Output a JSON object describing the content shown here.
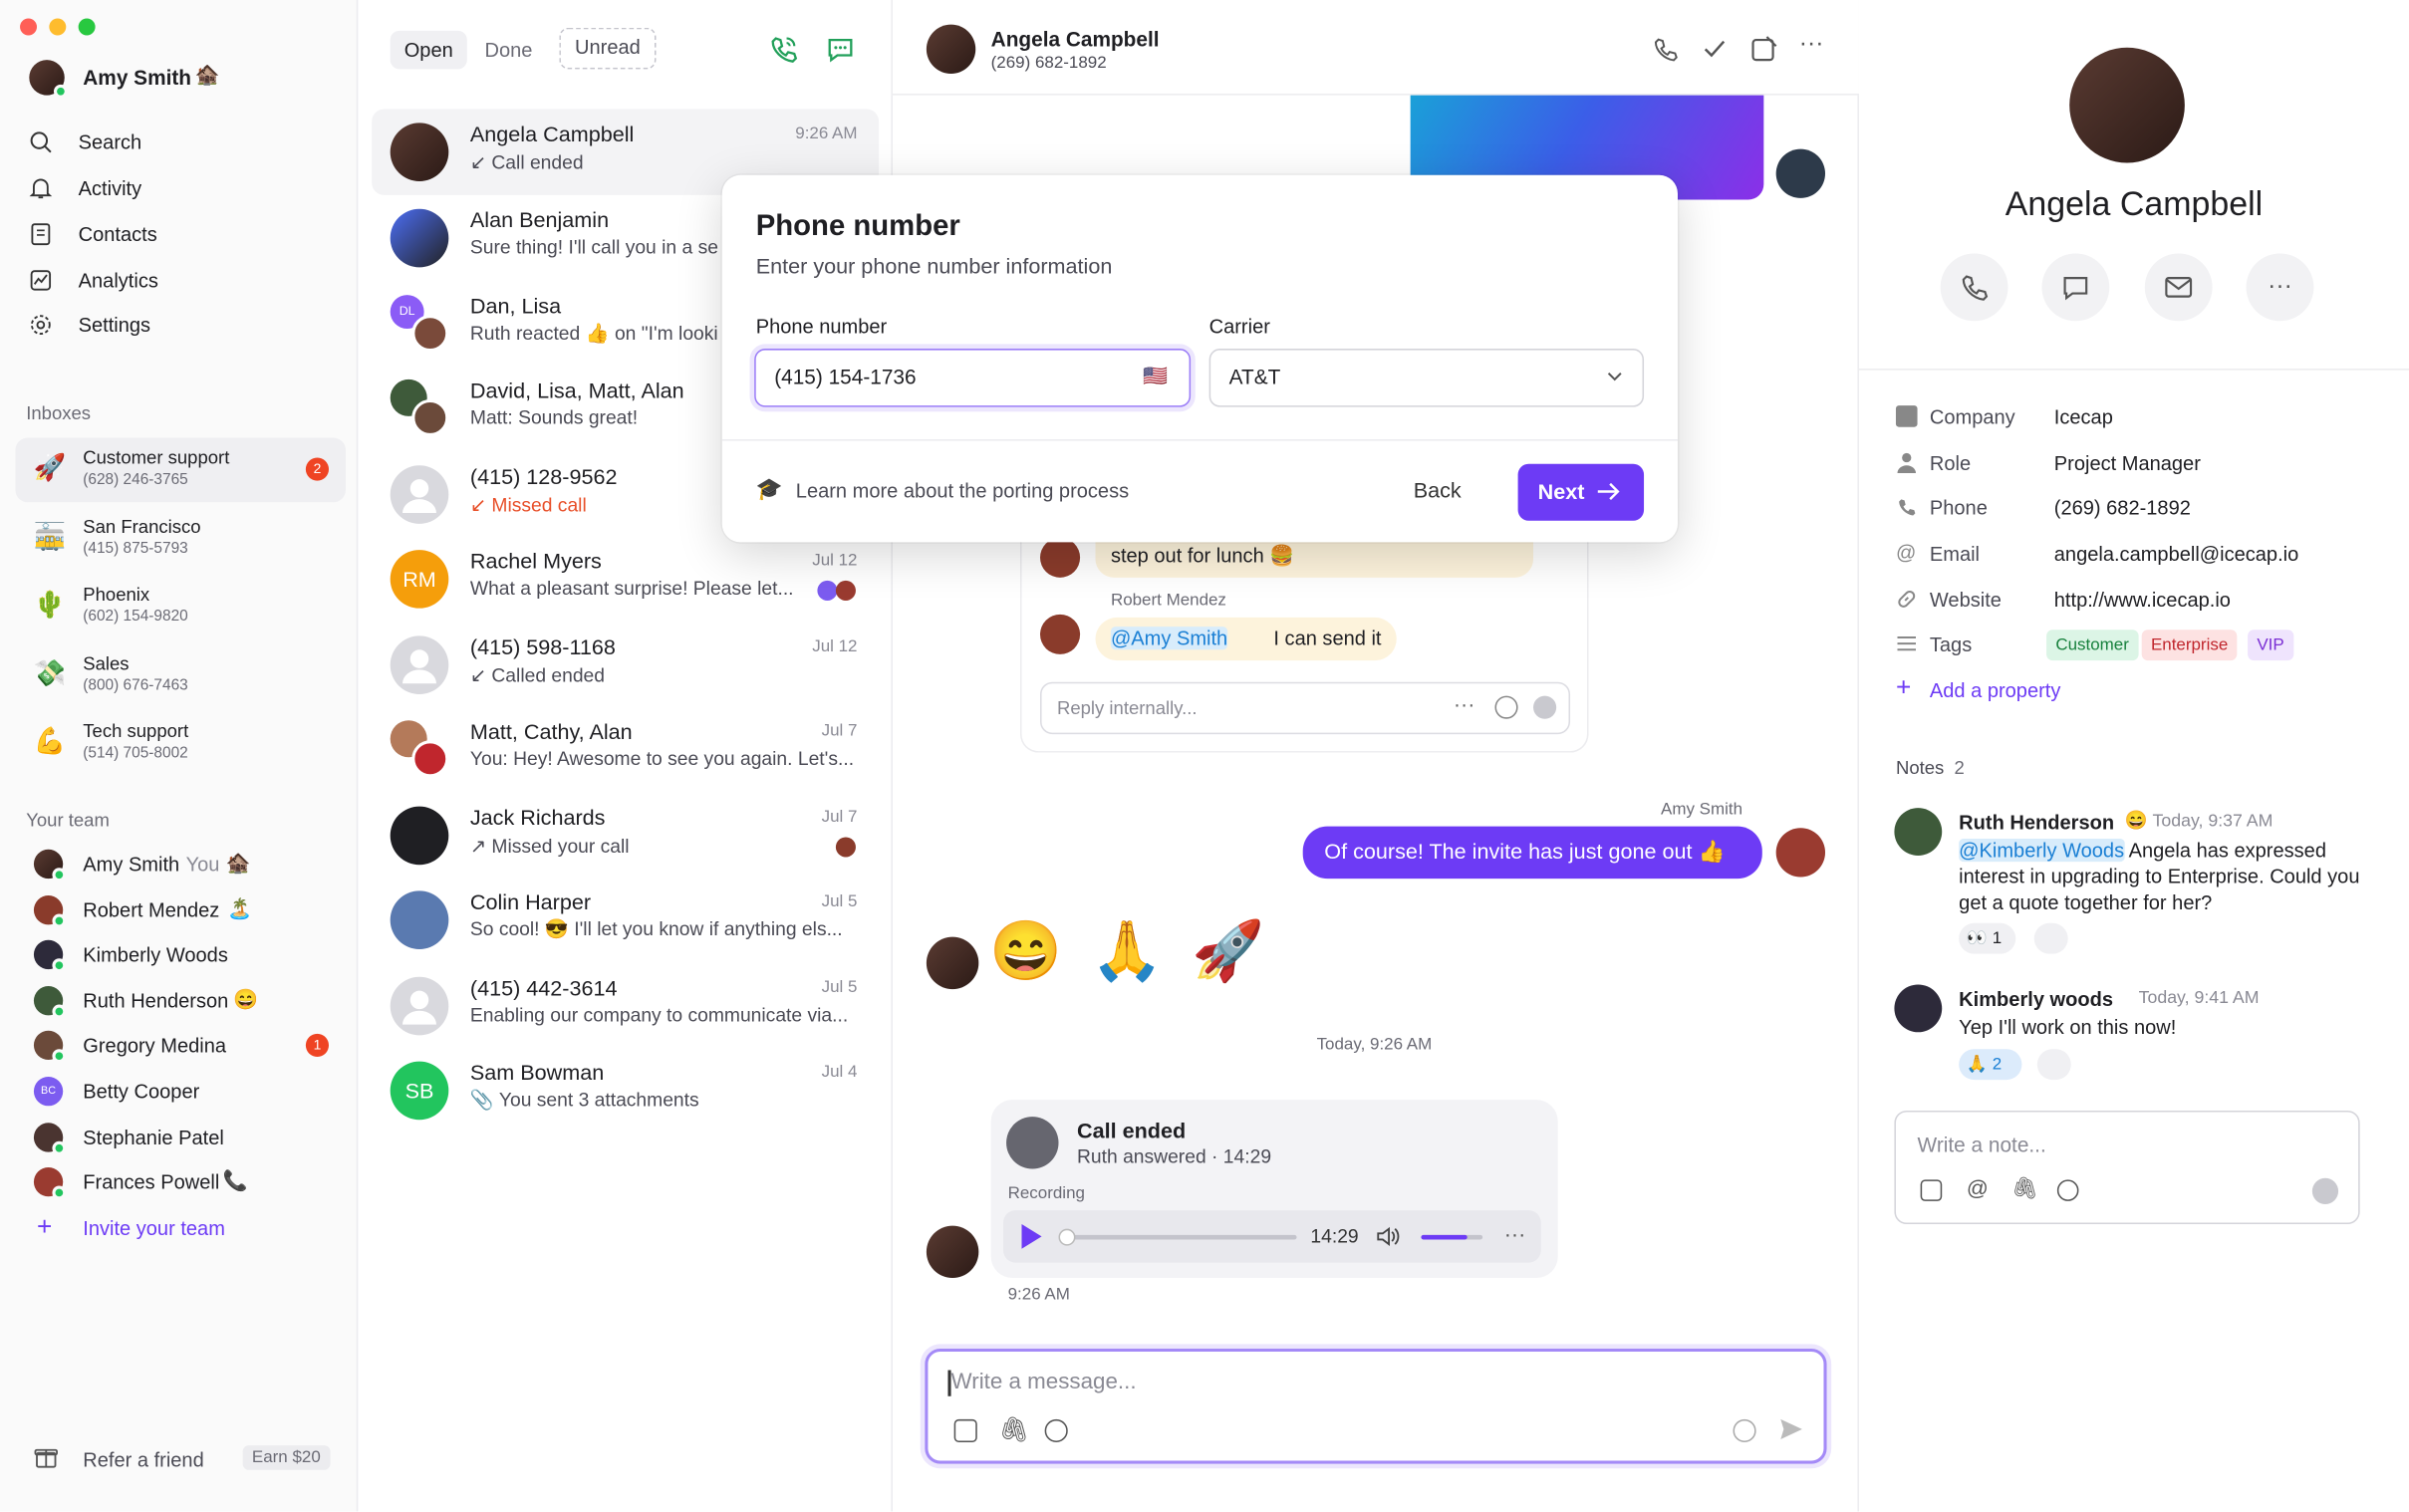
{
  "user": {
    "name": "Amy Smith",
    "emoji": "🏚️"
  },
  "nav": [
    {
      "label": "Search",
      "icon": "search-icon"
    },
    {
      "label": "Activity",
      "icon": "bell-icon"
    },
    {
      "label": "Contacts",
      "icon": "contacts-icon"
    },
    {
      "label": "Analytics",
      "icon": "analytics-icon"
    },
    {
      "label": "Settings",
      "icon": "gear-icon"
    }
  ],
  "inboxes_title": "Inboxes",
  "inboxes": [
    {
      "emoji": "🚀",
      "name": "Customer support",
      "phone": "(628) 246-3765",
      "badge": "2"
    },
    {
      "emoji": "🚋",
      "name": "San Francisco",
      "phone": "(415) 875-5793"
    },
    {
      "emoji": "🌵",
      "name": "Phoenix",
      "phone": "(602) 154-9820"
    },
    {
      "emoji": "💸",
      "name": "Sales",
      "phone": "(800) 676-7463"
    },
    {
      "emoji": "💪",
      "name": "Tech support",
      "phone": "(514) 705-8002"
    }
  ],
  "team_title": "Your team",
  "team": [
    {
      "name": "Amy Smith",
      "suffix": "You",
      "emoji": "🏚️"
    },
    {
      "name": "Robert Mendez",
      "emoji": "🏝️"
    },
    {
      "name": "Kimberly Woods"
    },
    {
      "name": "Ruth Henderson",
      "emoji": "😄"
    },
    {
      "name": "Gregory Medina",
      "badge": "1"
    },
    {
      "name": "Betty Cooper",
      "initials": "BC"
    },
    {
      "name": "Stephanie Patel"
    },
    {
      "name": "Frances Powell",
      "emoji": "📞"
    }
  ],
  "invite_label": "Invite your team",
  "refer": {
    "label": "Refer a friend",
    "reward": "Earn $20"
  },
  "filters": {
    "open": "Open",
    "done": "Done",
    "unread": "Unread"
  },
  "conversations": [
    {
      "name": "Angela Campbell",
      "preview": "↙ Call ended",
      "time": "9:26 AM"
    },
    {
      "name": "Alan Benjamin",
      "preview": "Sure thing! I'll call you in a se"
    },
    {
      "name": "Dan, Lisa",
      "preview": "Ruth reacted 👍 on \"I'm looki",
      "initials": "DL"
    },
    {
      "name": "David, Lisa, Matt, Alan",
      "preview": "Matt: Sounds great!"
    },
    {
      "name": "(415) 128-9562",
      "preview": "↙ Missed call"
    },
    {
      "name": "Rachel Myers",
      "preview": "What a pleasant surprise! Please let...",
      "time": "Jul 12",
      "initials": "RM"
    },
    {
      "name": "(415) 598-1168",
      "preview": "↙ Called ended",
      "time": "Jul 12"
    },
    {
      "name": "Matt, Cathy, Alan",
      "preview": "You: Hey! Awesome to see you again. Let's...",
      "time": "Jul 7"
    },
    {
      "name": "Jack Richards",
      "preview": "↗ Missed your call",
      "time": "Jul 7"
    },
    {
      "name": "Colin Harper",
      "preview": "So cool! 😎 I'll let you know if anything els...",
      "time": "Jul 5"
    },
    {
      "name": "(415) 442-3614",
      "preview": "Enabling our company to communicate via...",
      "time": "Jul 5"
    },
    {
      "name": "Sam Bowman",
      "preview": "📎 You sent 3 attachments",
      "time": "Jul 4",
      "initials": "SB"
    }
  ],
  "chat": {
    "name": "Angela Campbell",
    "phone": "(269) 682-1892",
    "lunch_text": "step out for lunch 🍔",
    "internal_author": "Robert Mendez",
    "internal_mention": "@Amy Smith",
    "internal_text": "I can send it",
    "reply_placeholder": "Reply internally...",
    "out_author": "Amy Smith",
    "out_text": "Of course! The invite has just gone out 👍",
    "emojis": "😄 🙏 🚀",
    "divider": "Today, 9:26 AM",
    "call": {
      "title": "Call ended",
      "sub": "Ruth answered · 14:29",
      "recording": "Recording",
      "duration": "14:29",
      "progress": 0.02,
      "volume": 0.75,
      "time": "9:26 AM"
    },
    "composer_placeholder": "Write a message..."
  },
  "modal": {
    "title": "Phone number",
    "subtitle": "Enter your phone number information",
    "phone_label": "Phone number",
    "phone_value": "(415) 154-1736",
    "flag": "🇺🇸",
    "carrier_label": "Carrier",
    "carrier_value": "AT&T",
    "learn": "Learn more about the porting process",
    "back": "Back",
    "next": "Next"
  },
  "contact": {
    "name": "Angela Campbell",
    "props": [
      {
        "k": "Company",
        "v": "Icecap",
        "icon": "building-icon"
      },
      {
        "k": "Role",
        "v": "Project Manager",
        "icon": "person-icon"
      },
      {
        "k": "Phone",
        "v": "(269) 682-1892",
        "icon": "phone-icon"
      },
      {
        "k": "Email",
        "v": "angela.campbell@icecap.io",
        "icon": "at-icon"
      },
      {
        "k": "Website",
        "v": "http://www.icecap.io",
        "icon": "link-icon"
      }
    ],
    "tags_label": "Tags",
    "tags": [
      {
        "t": "Customer",
        "bg": "#dcf5e6",
        "fg": "#16803c"
      },
      {
        "t": "Enterprise",
        "bg": "#fde2e2",
        "fg": "#c0262d"
      },
      {
        "t": "VIP",
        "bg": "#efe4fd",
        "fg": "#7b2fd4"
      }
    ],
    "add_property": "Add a property",
    "notes_title": "Notes",
    "notes_count": "2",
    "notes": [
      {
        "author": "Ruth Henderson",
        "emoji": "😄",
        "time": "Today, 9:37 AM",
        "mention": "@Kimberly Woods",
        "text": " Angela has expressed interest in upgrading to Enterprise. Could you get a quote together for her?",
        "react": "👀",
        "count": "1"
      },
      {
        "author": "Kimberly woods",
        "time": "Today, 9:41 AM",
        "text": "Yep I'll work on this now!",
        "react": "🙏",
        "count": "2"
      }
    ],
    "note_placeholder": "Write a note..."
  },
  "colors": {
    "accent": "#6d3bf5",
    "badge": "#ef4423",
    "green": "#22a05a",
    "missed": "#e8502a"
  }
}
